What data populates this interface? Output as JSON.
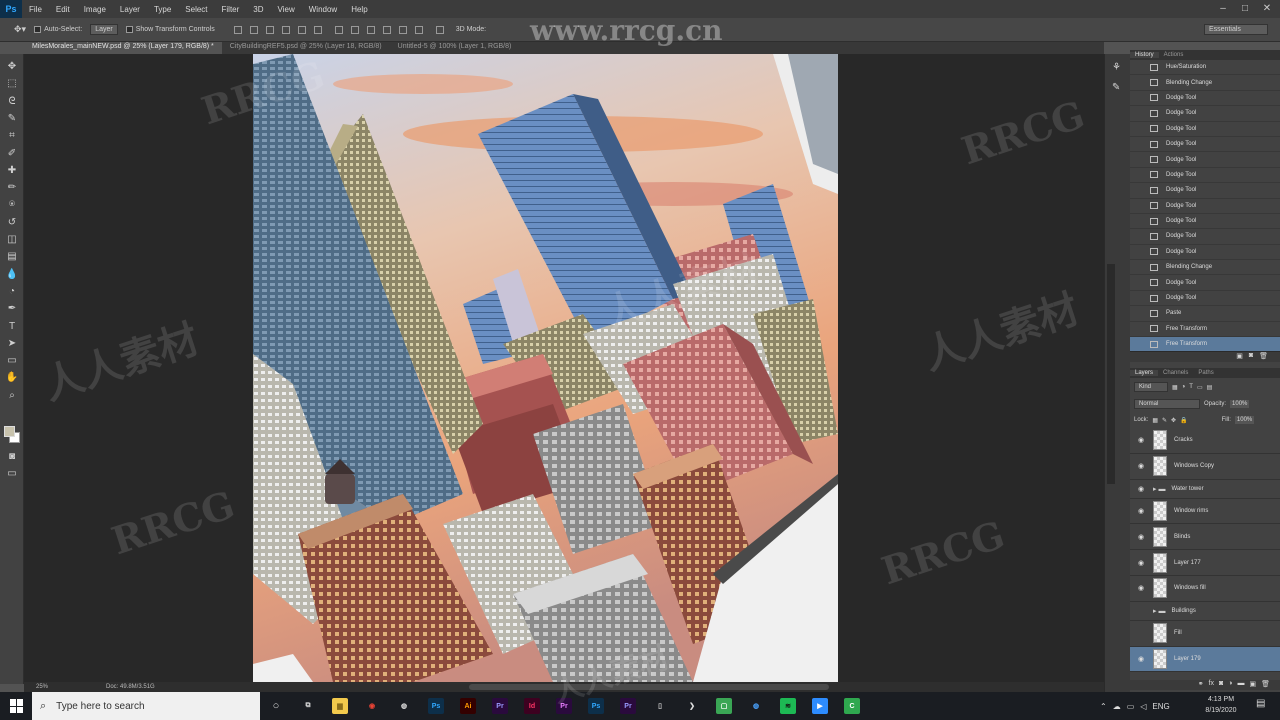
{
  "app": {
    "logo": "Ps"
  },
  "menu": [
    "File",
    "Edit",
    "Image",
    "Layer",
    "Type",
    "Select",
    "Filter",
    "3D",
    "View",
    "Window",
    "Help"
  ],
  "window_controls": [
    "–",
    "□",
    "✕"
  ],
  "options": {
    "auto_select_label": "Auto-Select:",
    "auto_select_value": "Layer",
    "transform_label": "Show Transform Controls",
    "mode_3d_label": "3D Mode:",
    "workspace": "Essentials"
  },
  "tabs": [
    {
      "label": "MilesMorales_mainNEW.psd @ 25% (Layer 179, RGB/8) *",
      "active": true
    },
    {
      "label": "CityBuildingREF5.psd @ 25% (Layer 18, RGB/8)",
      "active": false
    },
    {
      "label": "Untitled-5 @ 100% (Layer 1, RGB/8)",
      "active": false
    }
  ],
  "tools": [
    "move-icon",
    "marquee-icon",
    "lasso-icon",
    "quick-select-icon",
    "crop-icon",
    "eyedropper-icon",
    "healing-icon",
    "brush-icon",
    "clone-stamp-icon",
    "history-brush-icon",
    "eraser-icon",
    "gradient-icon",
    "blur-icon",
    "dodge-icon",
    "pen-icon",
    "type-icon",
    "path-select-icon",
    "shape-icon",
    "hand-icon",
    "zoom-icon"
  ],
  "tool_glyphs": [
    "✥",
    "⬚",
    "ᘓ",
    "✎",
    "⌗",
    "✐",
    "✚",
    "✏",
    "⍟",
    "↺",
    "◫",
    "▤",
    "💧",
    "◔",
    "✒",
    "T",
    "➤",
    "▭",
    "✋",
    "⌕"
  ],
  "status": {
    "zoom": "25%",
    "doc": "Doc: 49.8M/3.51G"
  },
  "history": {
    "tabs": [
      "History",
      "Actions"
    ],
    "items": [
      "Hue/Saturation",
      "Blending Change",
      "Dodge Tool",
      "Dodge Tool",
      "Dodge Tool",
      "Dodge Tool",
      "Dodge Tool",
      "Dodge Tool",
      "Dodge Tool",
      "Dodge Tool",
      "Dodge Tool",
      "Dodge Tool",
      "Dodge Tool",
      "Blending Change",
      "Dodge Tool",
      "Dodge Tool",
      "Paste",
      "Free Transform",
      "Free Transform"
    ],
    "selected_index": 18
  },
  "layers": {
    "tabs": [
      "Layers",
      "Channels",
      "Paths"
    ],
    "filter": "Kind",
    "blend_mode": "Normal",
    "opacity_label": "Opacity:",
    "opacity": "100%",
    "lock_label": "Lock:",
    "fill_label": "Fill:",
    "fill": "100%",
    "items": [
      {
        "name": "Cracks",
        "type": "layer",
        "visible": true
      },
      {
        "name": "Windows Copy",
        "type": "layer",
        "visible": true
      },
      {
        "name": "Water tower",
        "type": "group",
        "visible": true
      },
      {
        "name": "Window rims",
        "type": "layer",
        "visible": true
      },
      {
        "name": "Blinds",
        "type": "layer",
        "visible": true
      },
      {
        "name": "Layer 177",
        "type": "layer",
        "visible": true
      },
      {
        "name": "Windows fill",
        "type": "layer",
        "visible": true
      },
      {
        "name": "Buildings",
        "type": "group",
        "visible": false
      },
      {
        "name": "Fill",
        "type": "layer",
        "visible": false
      },
      {
        "name": "Layer 179",
        "type": "layer",
        "visible": true,
        "selected": true
      }
    ]
  },
  "taskbar": {
    "search_placeholder": "Type here to search",
    "language": "ENG",
    "time": "4:13 PM",
    "date": "8/19/2020",
    "apps": [
      {
        "name": "task-view-icon",
        "glyph": "⧉",
        "bg": "transparent",
        "fg": "#ddd"
      },
      {
        "name": "file-explorer-icon",
        "glyph": "▆",
        "bg": "#f2c94c",
        "fg": "#8a6d1a"
      },
      {
        "name": "chrome-icon",
        "glyph": "◉",
        "bg": "transparent",
        "fg": "#e94335"
      },
      {
        "name": "obs-icon",
        "glyph": "◍",
        "bg": "transparent",
        "fg": "#ddd"
      },
      {
        "name": "photoshop-icon",
        "glyph": "Ps",
        "bg": "#0d2f4a",
        "fg": "#31a8ff"
      },
      {
        "name": "illustrator-icon",
        "glyph": "Ai",
        "bg": "#330000",
        "fg": "#ff9a00"
      },
      {
        "name": "premiere-icon",
        "glyph": "Pr",
        "bg": "#2a0a3d",
        "fg": "#9999ff"
      },
      {
        "name": "indesign-icon",
        "glyph": "Id",
        "bg": "#3d0120",
        "fg": "#ff3366"
      },
      {
        "name": "premiere-rush-icon",
        "glyph": "Pr",
        "bg": "#2a0a3d",
        "fg": "#e77bff"
      },
      {
        "name": "photoshop-2-icon",
        "glyph": "Ps",
        "bg": "#0d2f4a",
        "fg": "#31a8ff"
      },
      {
        "name": "premiere-2-icon",
        "glyph": "Pr",
        "bg": "#2a0a3d",
        "fg": "#9999ff"
      },
      {
        "name": "usb-icon",
        "glyph": "▯",
        "bg": "transparent",
        "fg": "#ccc"
      },
      {
        "name": "arrow-app-icon",
        "glyph": "❯",
        "bg": "transparent",
        "fg": "#ddd"
      },
      {
        "name": "green-app-icon",
        "glyph": "▢",
        "bg": "#3aa655",
        "fg": "#fff"
      },
      {
        "name": "globe-icon",
        "glyph": "◍",
        "bg": "transparent",
        "fg": "#4aa3ff"
      },
      {
        "name": "spotify-icon",
        "glyph": "≋",
        "bg": "#1db954",
        "fg": "#111"
      },
      {
        "name": "zoom-app-icon",
        "glyph": "▶",
        "bg": "#2d8cff",
        "fg": "#fff"
      },
      {
        "name": "camtasia-icon",
        "glyph": "C",
        "bg": "#2fa84f",
        "fg": "#fff"
      }
    ]
  },
  "watermark": {
    "url": "www.rrcg.cn",
    "latin": "RRCG",
    "cjk": "人人素材"
  }
}
